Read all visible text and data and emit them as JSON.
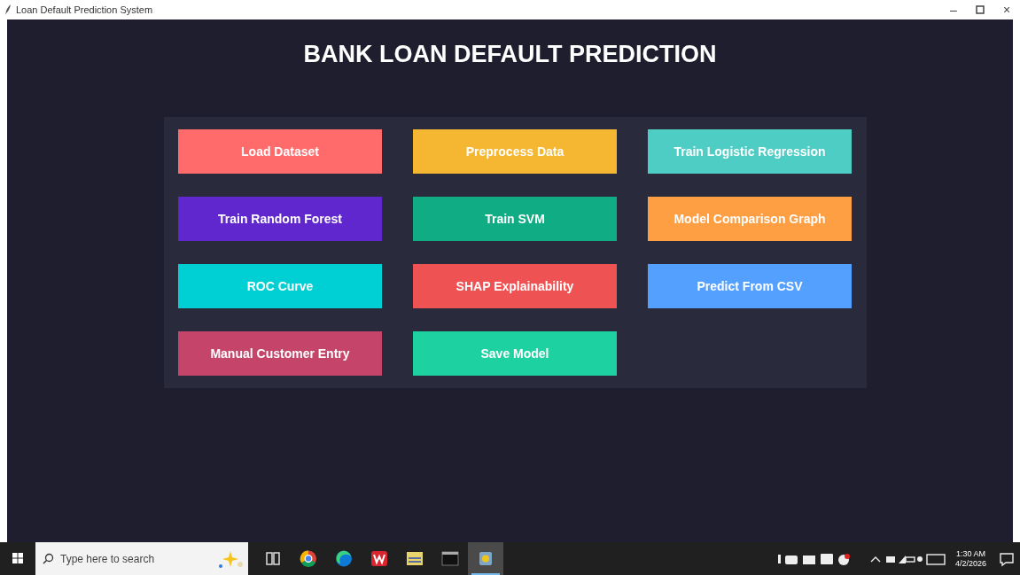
{
  "window": {
    "title": "Loan Default Prediction System",
    "minimize": "–",
    "close": "×"
  },
  "heading": "BANK LOAN DEFAULT PREDICTION",
  "buttons": [
    {
      "label": "Load Dataset",
      "color": "#ff6b6b"
    },
    {
      "label": "Preprocess Data",
      "color": "#f5b731"
    },
    {
      "label": "Train Logistic Regression",
      "color": "#4ecdc4"
    },
    {
      "label": "Train Random Forest",
      "color": "#5f27cd"
    },
    {
      "label": "Train SVM",
      "color": "#10ac84"
    },
    {
      "label": "Model Comparison Graph",
      "color": "#ff9f43"
    },
    {
      "label": "ROC Curve",
      "color": "#00cfd3"
    },
    {
      "label": "SHAP Explainability",
      "color": "#ee5253"
    },
    {
      "label": "Predict From CSV",
      "color": "#54a0ff"
    },
    {
      "label": "Manual Customer Entry",
      "color": "#c44569"
    },
    {
      "label": "Save Model",
      "color": "#1dd1a1"
    }
  ],
  "taskbar": {
    "search": {
      "placeholder": "Type here to search"
    },
    "time": "1:30 AM",
    "date": "4/2/2026"
  }
}
